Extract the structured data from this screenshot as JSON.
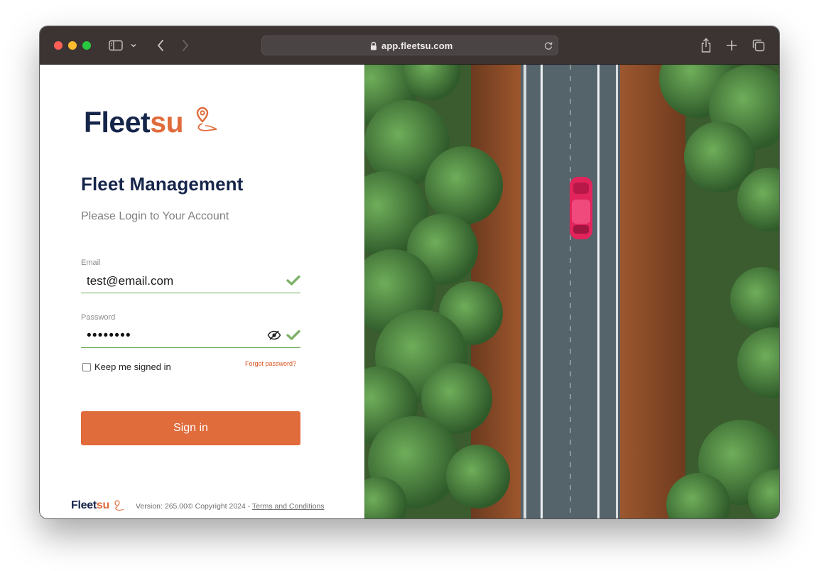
{
  "browser": {
    "url": "app.fleetsu.com",
    "icons": [
      "sidebar-icon",
      "chevron-down-icon",
      "back-icon",
      "forward-icon",
      "lock-icon",
      "reload-icon",
      "share-icon",
      "plus-icon",
      "tabs-icon"
    ]
  },
  "brand": {
    "name_part1": "Fleet",
    "name_part2": "su",
    "primary_color": "#16254a",
    "accent_color": "#e06b3b"
  },
  "login": {
    "heading": "Fleet Management",
    "subheading": "Please Login to Your Account",
    "email_label": "Email",
    "email_value": "test@email.com",
    "password_label": "Password",
    "password_masked": "••••••••",
    "keep_signed_in_label": "Keep me signed in",
    "keep_signed_in_checked": false,
    "forgot_password": "Forgot password?",
    "sign_in_label": "Sign in",
    "valid_color": "#6aa84f"
  },
  "footer": {
    "version_text": "Version: 265.00© Copyright 2024 - ",
    "terms_link": "Terms and Conditions"
  }
}
